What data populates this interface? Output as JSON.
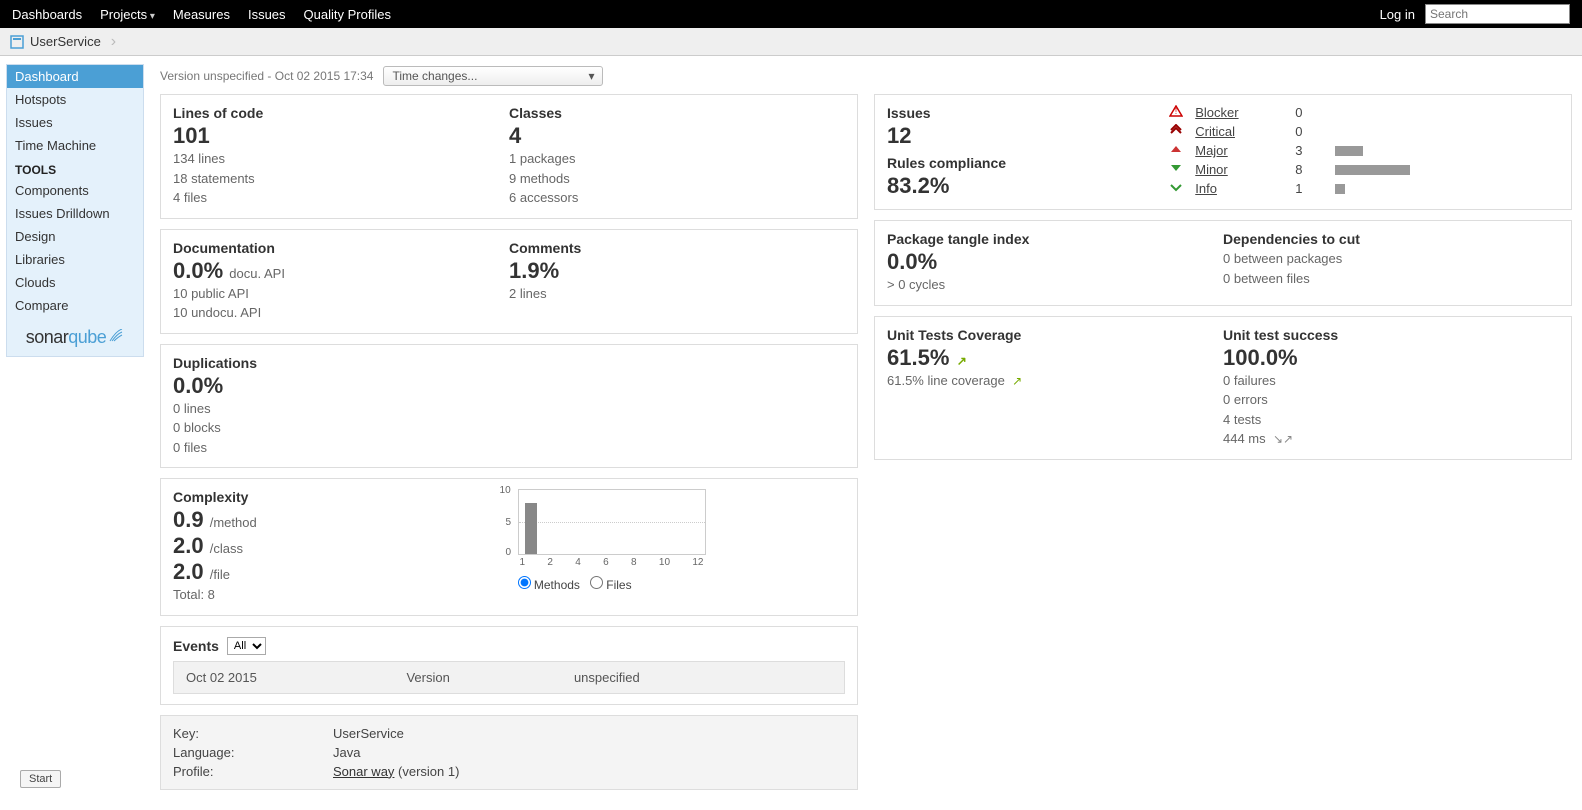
{
  "topbar": {
    "items": [
      "Dashboards",
      "Projects",
      "Measures",
      "Issues",
      "Quality Profiles"
    ],
    "login": "Log in",
    "search_placeholder": "Search"
  },
  "breadcrumb": {
    "project": "UserService"
  },
  "sidebar": {
    "nav": [
      "Dashboard",
      "Hotspots",
      "Issues",
      "Time Machine"
    ],
    "tools_heading": "TOOLS",
    "tools": [
      "Components",
      "Issues Drilldown",
      "Design",
      "Libraries",
      "Clouds",
      "Compare"
    ]
  },
  "version": {
    "text": "Version unspecified - Oct 02 2015 17:34",
    "dropdown": "Time changes..."
  },
  "loc": {
    "title": "Lines of code",
    "value": "101",
    "sub": [
      "134 lines",
      "18 statements",
      "4 files"
    ]
  },
  "classes": {
    "title": "Classes",
    "value": "4",
    "sub": [
      "1 packages",
      "9 methods",
      "6 accessors"
    ]
  },
  "documentation": {
    "title": "Documentation",
    "value": "0.0%",
    "unit": "docu. API",
    "sub": [
      "10 public API",
      "10 undocu. API"
    ]
  },
  "comments": {
    "title": "Comments",
    "value": "1.9%",
    "sub": [
      "2 lines"
    ]
  },
  "duplications": {
    "title": "Duplications",
    "value": "0.0%",
    "sub": [
      "0 lines",
      "0 blocks",
      "0 files"
    ]
  },
  "complexity": {
    "title": "Complexity",
    "rows": [
      {
        "value": "0.9",
        "unit": "/method"
      },
      {
        "value": "2.0",
        "unit": "/class"
      },
      {
        "value": "2.0",
        "unit": "/file"
      }
    ],
    "total": "Total: 8",
    "radios": {
      "methods": "Methods",
      "files": "Files"
    }
  },
  "chart_data": {
    "type": "bar",
    "categories": [
      "1",
      "2",
      "4",
      "6",
      "8",
      "10",
      "12"
    ],
    "values": [
      8,
      0,
      0,
      0,
      0,
      0,
      0
    ],
    "title": "",
    "xlabel": "",
    "ylabel": "",
    "ylim": [
      0,
      10
    ],
    "yticks": [
      0,
      5,
      10
    ]
  },
  "events": {
    "title": "Events",
    "filter": "All",
    "row": {
      "date": "Oct 02 2015",
      "col1": "Version",
      "col2": "unspecified"
    }
  },
  "projinfo": {
    "key_label": "Key:",
    "key": "UserService",
    "lang_label": "Language:",
    "lang": "Java",
    "profile_label": "Profile:",
    "profile_link": "Sonar way",
    "profile_suffix": " (version 1)"
  },
  "issues": {
    "title": "Issues",
    "count": "12",
    "compliance_label": "Rules compliance",
    "compliance": "83.2%",
    "severities": [
      {
        "name": "Blocker",
        "count": "0",
        "bar": 0
      },
      {
        "name": "Critical",
        "count": "0",
        "bar": 0
      },
      {
        "name": "Major",
        "count": "3",
        "bar": 28
      },
      {
        "name": "Minor",
        "count": "8",
        "bar": 75
      },
      {
        "name": "Info",
        "count": "1",
        "bar": 10
      }
    ]
  },
  "tangle": {
    "title": "Package tangle index",
    "value": "0.0%",
    "sub": "> 0 cycles",
    "deps_title": "Dependencies to cut",
    "deps_sub": [
      "0 between packages",
      "0 between files"
    ]
  },
  "coverage": {
    "title": "Unit Tests Coverage",
    "value": "61.5%",
    "sub": "61.5% line coverage"
  },
  "tests": {
    "title": "Unit test success",
    "value": "100.0%",
    "sub": [
      "0 failures",
      "0 errors",
      "4 tests",
      "444 ms"
    ]
  },
  "start": "Start"
}
